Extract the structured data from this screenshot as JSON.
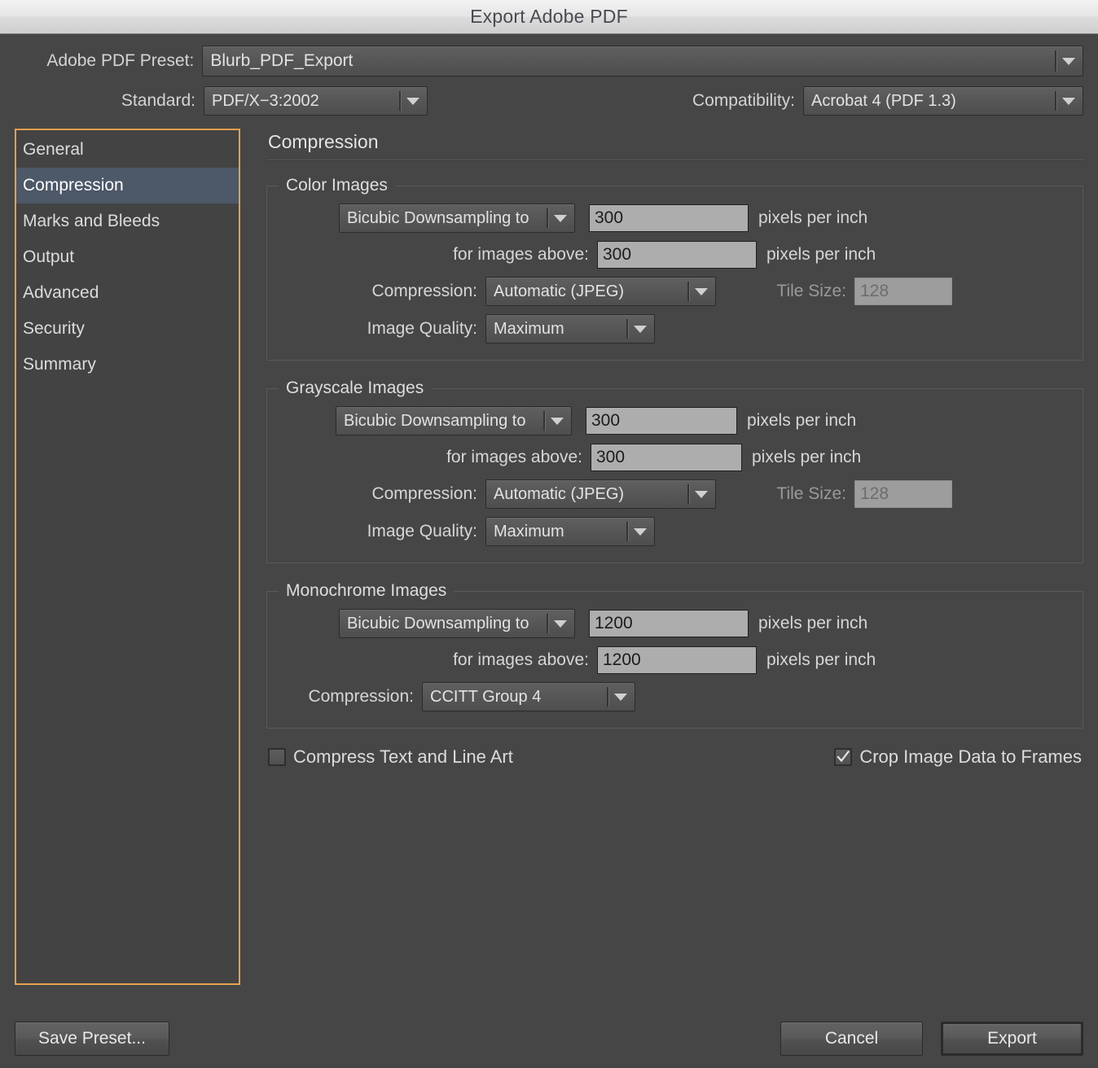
{
  "window": {
    "title": "Export Adobe PDF"
  },
  "header": {
    "preset_label": "Adobe PDF Preset:",
    "preset_value": "Blurb_PDF_Export",
    "standard_label": "Standard:",
    "standard_value": "PDF/X−3:2002",
    "compatibility_label": "Compatibility:",
    "compatibility_value": "Acrobat 4 (PDF 1.3)"
  },
  "sidebar": {
    "items": [
      {
        "label": "General",
        "selected": false
      },
      {
        "label": "Compression",
        "selected": true
      },
      {
        "label": "Marks and Bleeds",
        "selected": false
      },
      {
        "label": "Output",
        "selected": false
      },
      {
        "label": "Advanced",
        "selected": false
      },
      {
        "label": "Security",
        "selected": false
      },
      {
        "label": "Summary",
        "selected": false
      }
    ]
  },
  "panel": {
    "title": "Compression",
    "color_images": {
      "legend": "Color Images",
      "resample_value": "Bicubic Downsampling to",
      "ppi_value": "300",
      "ppi_unit": "pixels per inch",
      "for_images_above_label": "for images above:",
      "threshold_value": "300",
      "threshold_unit": "pixels per inch",
      "compression_label": "Compression:",
      "compression_value": "Automatic (JPEG)",
      "tile_size_label": "Tile Size:",
      "tile_size_value": "128",
      "quality_label": "Image Quality:",
      "quality_value": "Maximum"
    },
    "grayscale_images": {
      "legend": "Grayscale Images",
      "resample_value": "Bicubic Downsampling to",
      "ppi_value": "300",
      "ppi_unit": "pixels per inch",
      "for_images_above_label": "for images above:",
      "threshold_value": "300",
      "threshold_unit": "pixels per inch",
      "compression_label": "Compression:",
      "compression_value": "Automatic (JPEG)",
      "tile_size_label": "Tile Size:",
      "tile_size_value": "128",
      "quality_label": "Image Quality:",
      "quality_value": "Maximum"
    },
    "monochrome_images": {
      "legend": "Monochrome Images",
      "resample_value": "Bicubic Downsampling to",
      "ppi_value": "1200",
      "ppi_unit": "pixels per inch",
      "for_images_above_label": "for images above:",
      "threshold_value": "1200",
      "threshold_unit": "pixels per inch",
      "compression_label": "Compression:",
      "compression_value": "CCITT Group 4"
    },
    "checkboxes": {
      "compress_text_label": "Compress Text and Line Art",
      "compress_text_checked": false,
      "crop_image_label": "Crop Image Data to Frames",
      "crop_image_checked": true
    }
  },
  "footer": {
    "save_preset_label": "Save Preset...",
    "cancel_label": "Cancel",
    "export_label": "Export"
  },
  "colors": {
    "dialog_background": "#464646",
    "titlebar_text": "#4a4a52",
    "focus_ring": "#e9a14e",
    "selection": "#4d5868",
    "input_background": "#adadad",
    "input_disabled_text": "#6d6d6d",
    "label_text": "#d6d6d6"
  },
  "icons": {
    "dropdown_arrow": "chevron-down-icon",
    "checkmark": "check-icon"
  }
}
